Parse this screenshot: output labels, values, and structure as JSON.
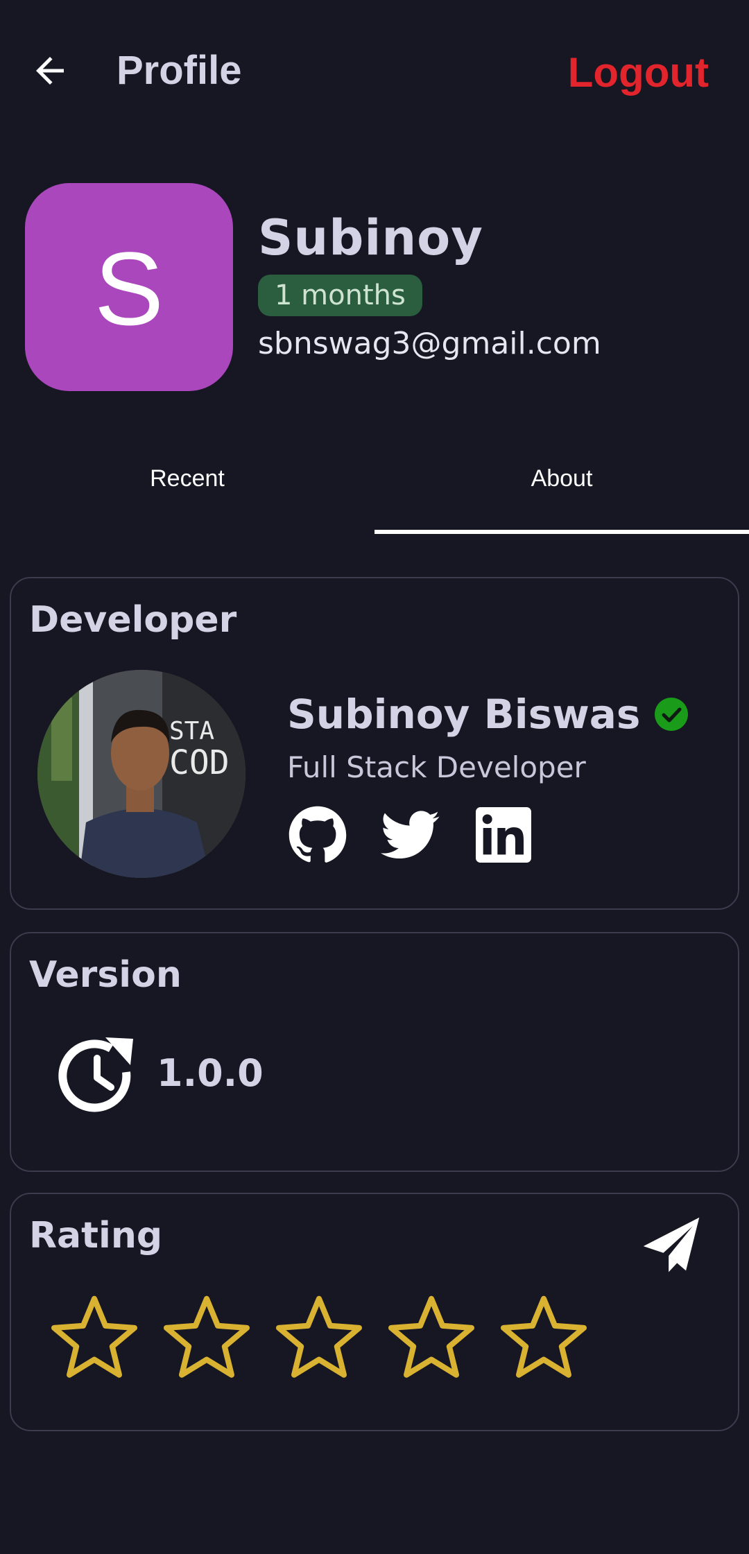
{
  "header": {
    "title": "Profile",
    "logout_label": "Logout",
    "back_icon": "arrow-left-icon"
  },
  "profile": {
    "avatar_letter": "S",
    "avatar_color": "#ab47bc",
    "name": "Subinoy",
    "tenure": "1 months",
    "email": "sbnswag3@gmail.com"
  },
  "tabs": [
    {
      "label": "Recent",
      "active": false
    },
    {
      "label": "About",
      "active": true
    }
  ],
  "developer": {
    "section_title": "Developer",
    "name": "Subinoy Biswas",
    "role": "Full Stack Developer",
    "verified_icon": "verified-check-icon",
    "socials": [
      "github-icon",
      "twitter-icon",
      "linkedin-icon"
    ]
  },
  "version": {
    "section_title": "Version",
    "number": "1.0.0",
    "icon": "update-clock-icon"
  },
  "rating": {
    "section_title": "Rating",
    "value": 0,
    "max": 5,
    "star_color": "#d9b232",
    "send_icon": "send-icon"
  },
  "colors": {
    "background": "#161722",
    "accent_logout": "#e2242c",
    "badge_bg": "#2b5e3f",
    "verified": "#1a9b1a"
  }
}
